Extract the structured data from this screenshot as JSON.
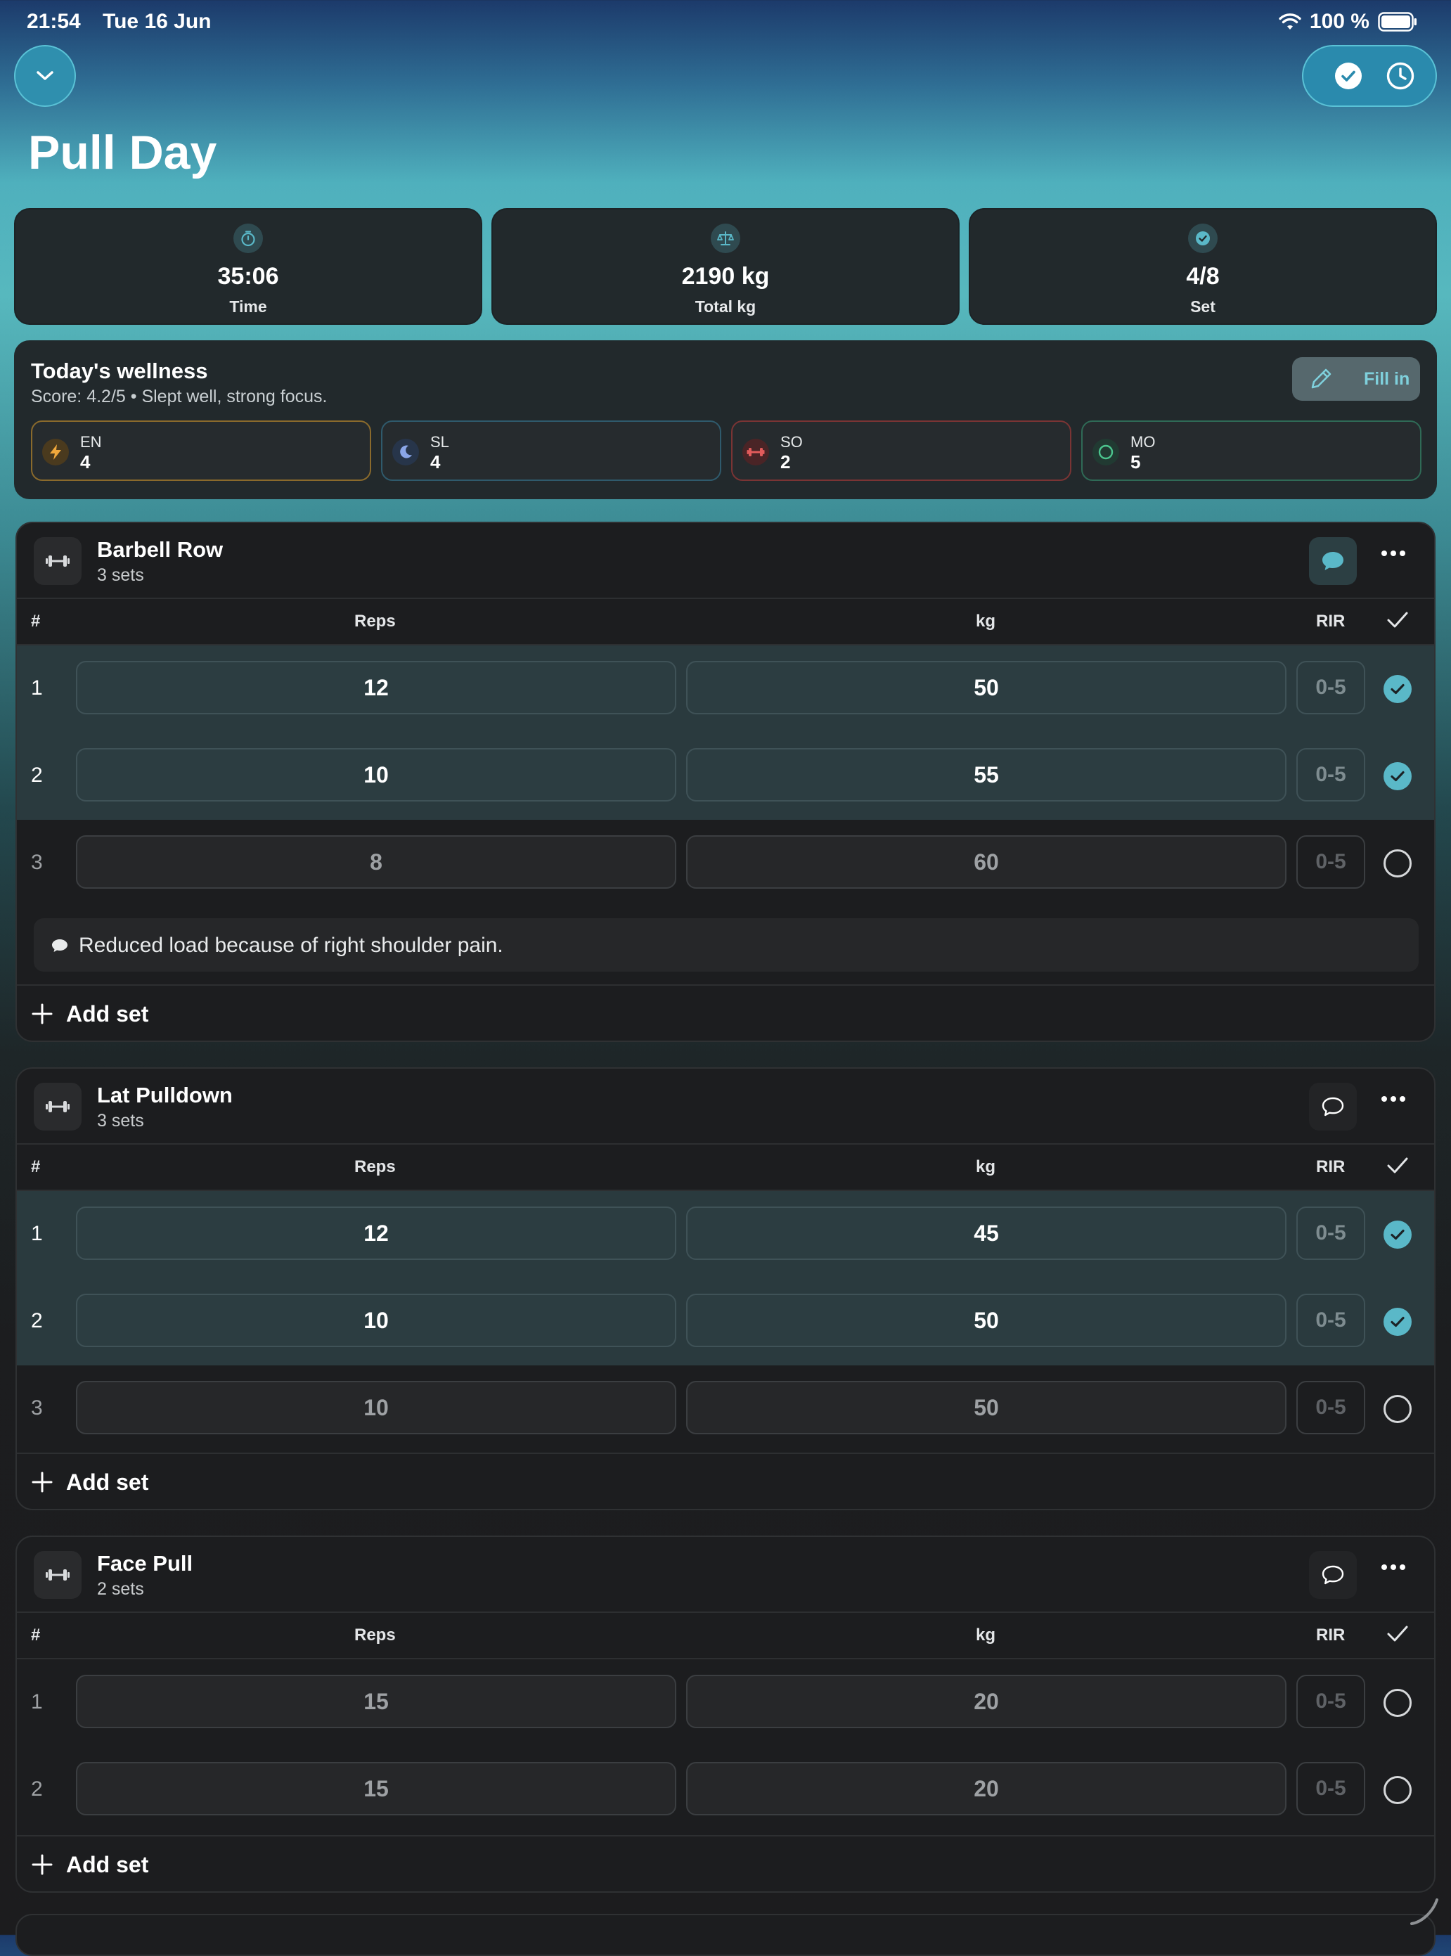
{
  "status": {
    "time": "21:54",
    "date": "Tue 16 Jun",
    "battery": "100 %"
  },
  "title": "Pull Day",
  "stats": [
    {
      "value": "35:06",
      "label": "Time",
      "icon": "stopwatch-icon"
    },
    {
      "value": "2190 kg",
      "label": "Total kg",
      "icon": "scale-icon"
    },
    {
      "value": "4/8",
      "label": "Set",
      "icon": "check-circle-icon"
    }
  ],
  "wellness": {
    "title": "Today's wellness",
    "summary": "Score: 4.2/5 • Slept well, strong focus.",
    "fill_label": "Fill in",
    "metrics": [
      {
        "key": "EN",
        "value": "4",
        "color": "#c9882a"
      },
      {
        "key": "SL",
        "value": "4",
        "color": "#3f6f86"
      },
      {
        "key": "SO",
        "value": "2",
        "color": "#a24545"
      },
      {
        "key": "MO",
        "value": "5",
        "color": "#3c7a5e"
      }
    ]
  },
  "columns": {
    "num": "#",
    "reps": "Reps",
    "kg": "kg",
    "rir": "RIR"
  },
  "rir_placeholder": "0-5",
  "add_set_label": "Add set",
  "exercises": [
    {
      "name": "Barbell Row",
      "sets_label": "3 sets",
      "has_note": true,
      "note": "Reduced load because of right shoulder pain.",
      "sets": [
        {
          "n": "1",
          "reps": "12",
          "kg": "50",
          "done": true
        },
        {
          "n": "2",
          "reps": "10",
          "kg": "55",
          "done": true
        },
        {
          "n": "3",
          "reps": "8",
          "kg": "60",
          "done": false
        }
      ]
    },
    {
      "name": "Lat Pulldown",
      "sets_label": "3 sets",
      "has_note": false,
      "sets": [
        {
          "n": "1",
          "reps": "12",
          "kg": "45",
          "done": true
        },
        {
          "n": "2",
          "reps": "10",
          "kg": "50",
          "done": true
        },
        {
          "n": "3",
          "reps": "10",
          "kg": "50",
          "done": false
        }
      ]
    },
    {
      "name": "Face Pull",
      "sets_label": "2 sets",
      "has_note": false,
      "sets": [
        {
          "n": "1",
          "reps": "15",
          "kg": "20",
          "done": false
        },
        {
          "n": "2",
          "reps": "15",
          "kg": "20",
          "done": false
        }
      ]
    }
  ],
  "colors": {
    "accent": "#5ab8c8",
    "card": "#1c1d1f",
    "done_row": "#2a3a3e"
  }
}
